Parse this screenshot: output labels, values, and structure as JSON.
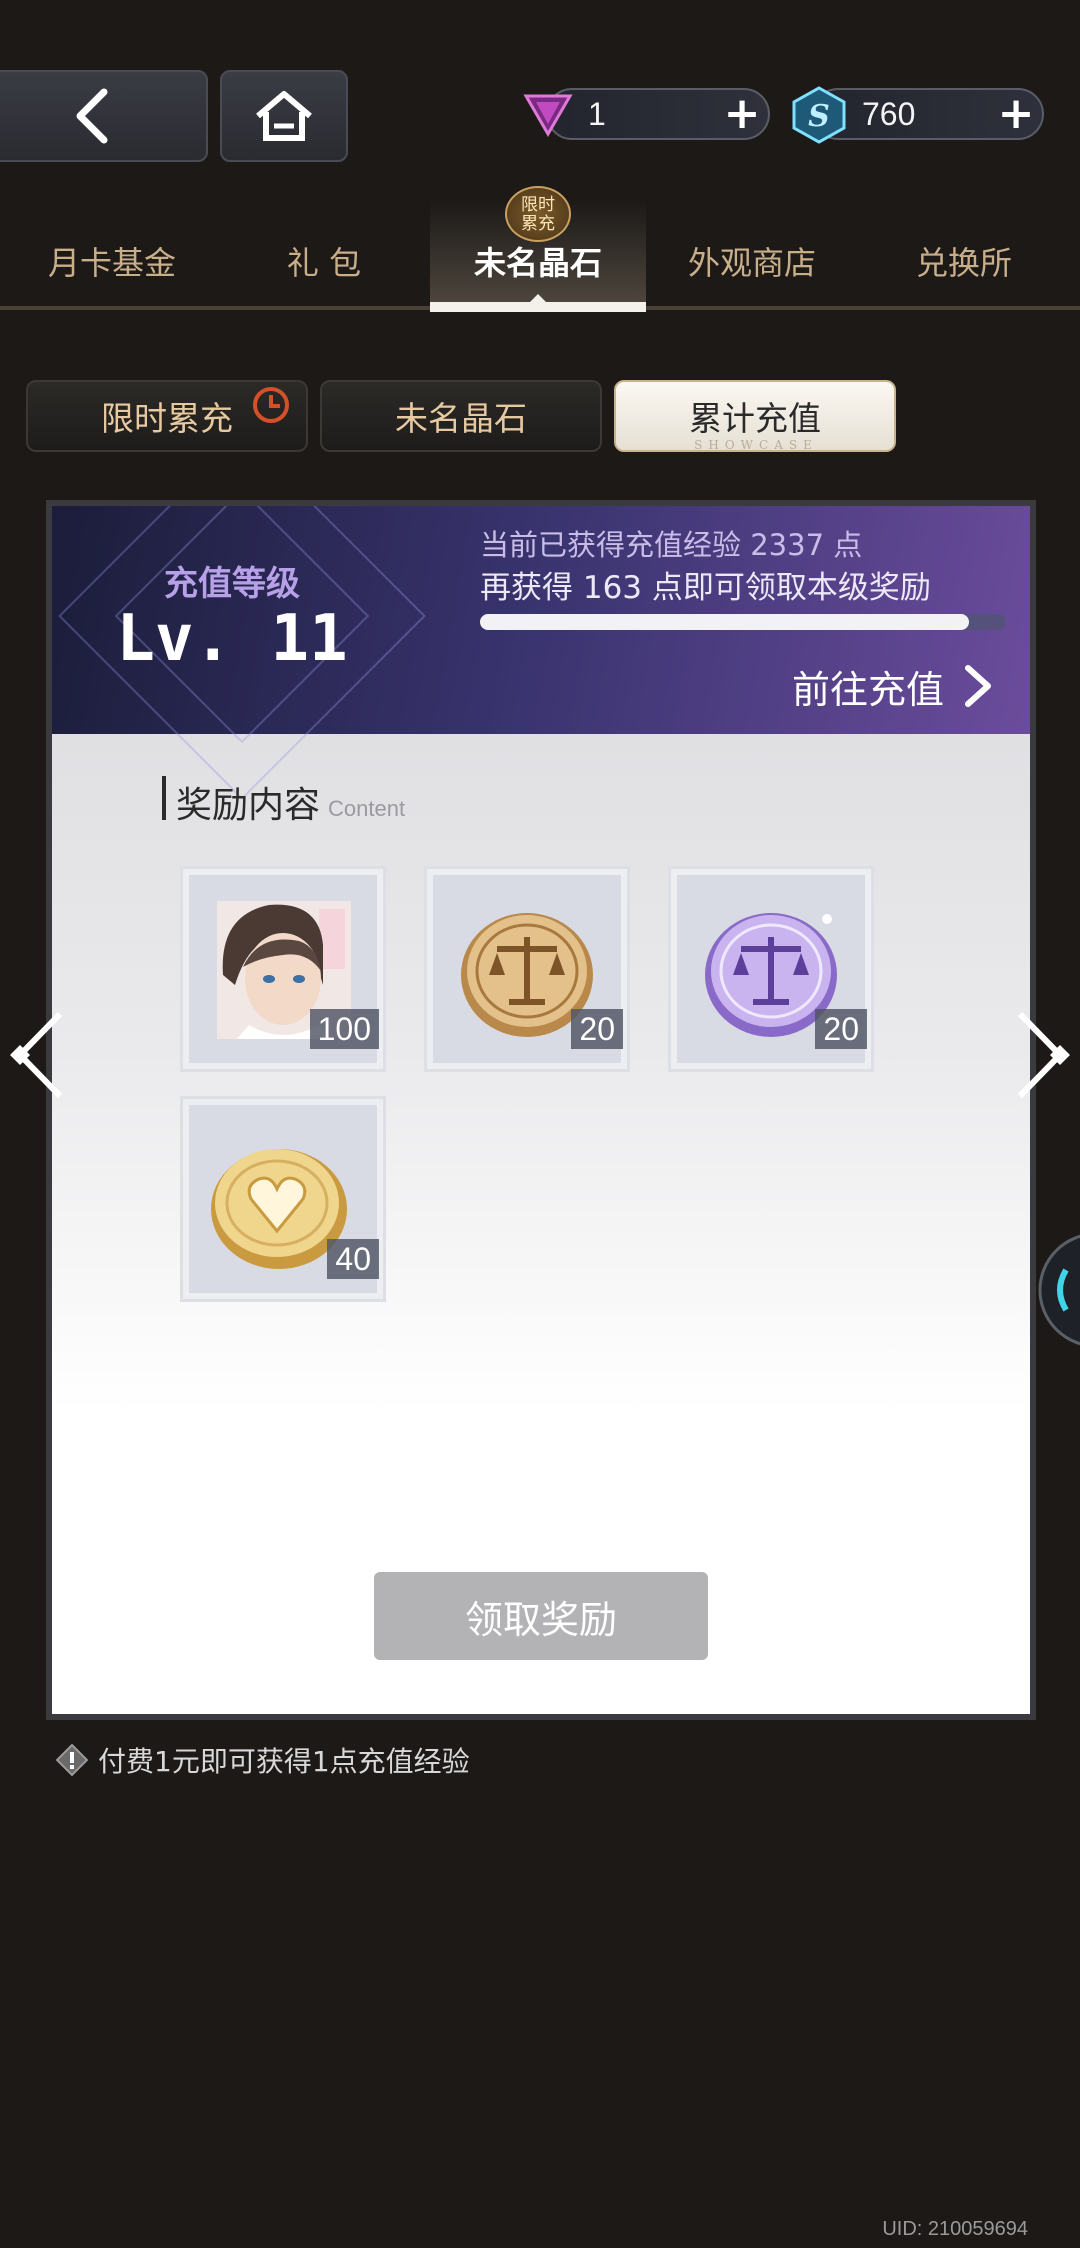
{
  "currencies": [
    {
      "name": "triangle-gem",
      "value": "1"
    },
    {
      "name": "s-crystal",
      "value": "760"
    }
  ],
  "tabs": [
    {
      "label": "月卡基金"
    },
    {
      "label": "礼 包"
    },
    {
      "label": "未名晶石",
      "active": true
    },
    {
      "label": "外观商店"
    },
    {
      "label": "兑换所"
    }
  ],
  "tab_badge": {
    "line1": "限时",
    "line2": "累充"
  },
  "subtabs": [
    {
      "label": "限时累充"
    },
    {
      "label": "未名晶石"
    },
    {
      "label": "累计充值",
      "active": true
    }
  ],
  "subtab_deco": "SHOWCASE",
  "level": {
    "title": "充值等级",
    "value": "Lv. 11",
    "exp_line": "当前已获得充值经验 2337 点",
    "need_line": "再获得 163 点即可领取本级奖励",
    "progress": 0.93,
    "recharge_label": "前往充值"
  },
  "rewards": {
    "heading": "奖励内容",
    "heading_en": "Content",
    "items": [
      {
        "icon": "character-portrait",
        "qty": "100"
      },
      {
        "icon": "gold-scale-coin",
        "qty": "20"
      },
      {
        "icon": "purple-scale-coin",
        "qty": "20"
      },
      {
        "icon": "gold-heart-coin",
        "qty": "40"
      }
    ]
  },
  "claim_label": "领取奖励",
  "footnote": "付费1元即可获得1点充值经验",
  "uid": "UID: 210059694",
  "colors": {
    "accent_gold": "#c9ae8a",
    "banner_purple": "#6b4c9c"
  }
}
